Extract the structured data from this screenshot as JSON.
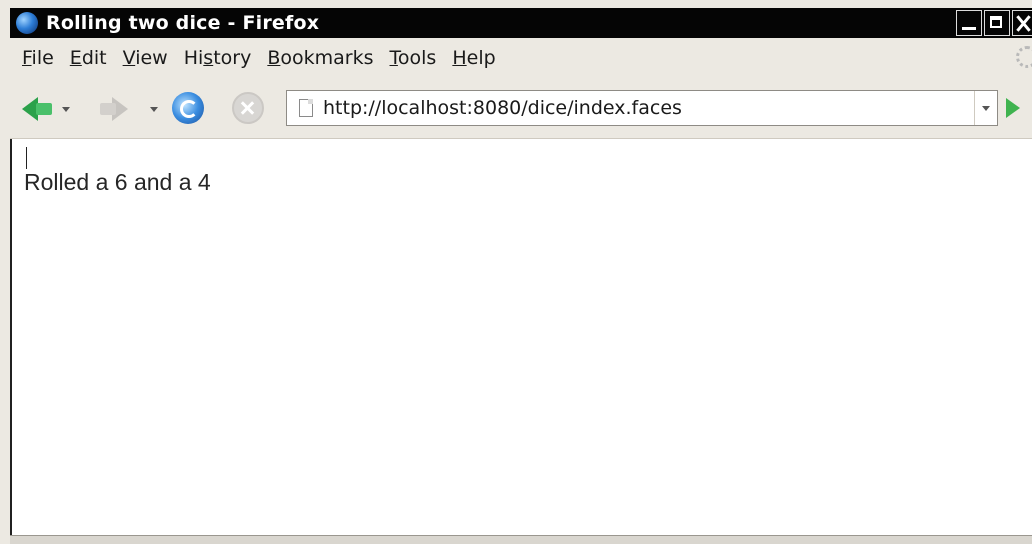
{
  "window": {
    "title": "Rolling two dice - Firefox"
  },
  "menu": {
    "items": [
      {
        "label": "File",
        "accel": "F",
        "rest": "ile"
      },
      {
        "label": "Edit",
        "accel": "E",
        "rest": "dit"
      },
      {
        "label": "View",
        "accel": "V",
        "rest": "iew"
      },
      {
        "label": "History",
        "pre": "Hi",
        "accel": "s",
        "rest": "tory"
      },
      {
        "label": "Bookmarks",
        "accel": "B",
        "rest": "ookmarks"
      },
      {
        "label": "Tools",
        "accel": "T",
        "rest": "ools"
      },
      {
        "label": "Help",
        "accel": "H",
        "rest": "elp"
      }
    ]
  },
  "toolbar": {
    "icons": [
      "back-icon",
      "forward-icon",
      "reload-icon",
      "stop-icon",
      "page-icon",
      "go-icon"
    ]
  },
  "urlbar": {
    "value": "http://localhost:8080/dice/index.faces"
  },
  "page": {
    "message": "Rolled a 6 and a 4"
  },
  "colors": {
    "titlebar": "#050505",
    "chrome": "#ece9e2",
    "back_arrow": "#2ba14a",
    "go_arrow": "#3fb34f"
  }
}
